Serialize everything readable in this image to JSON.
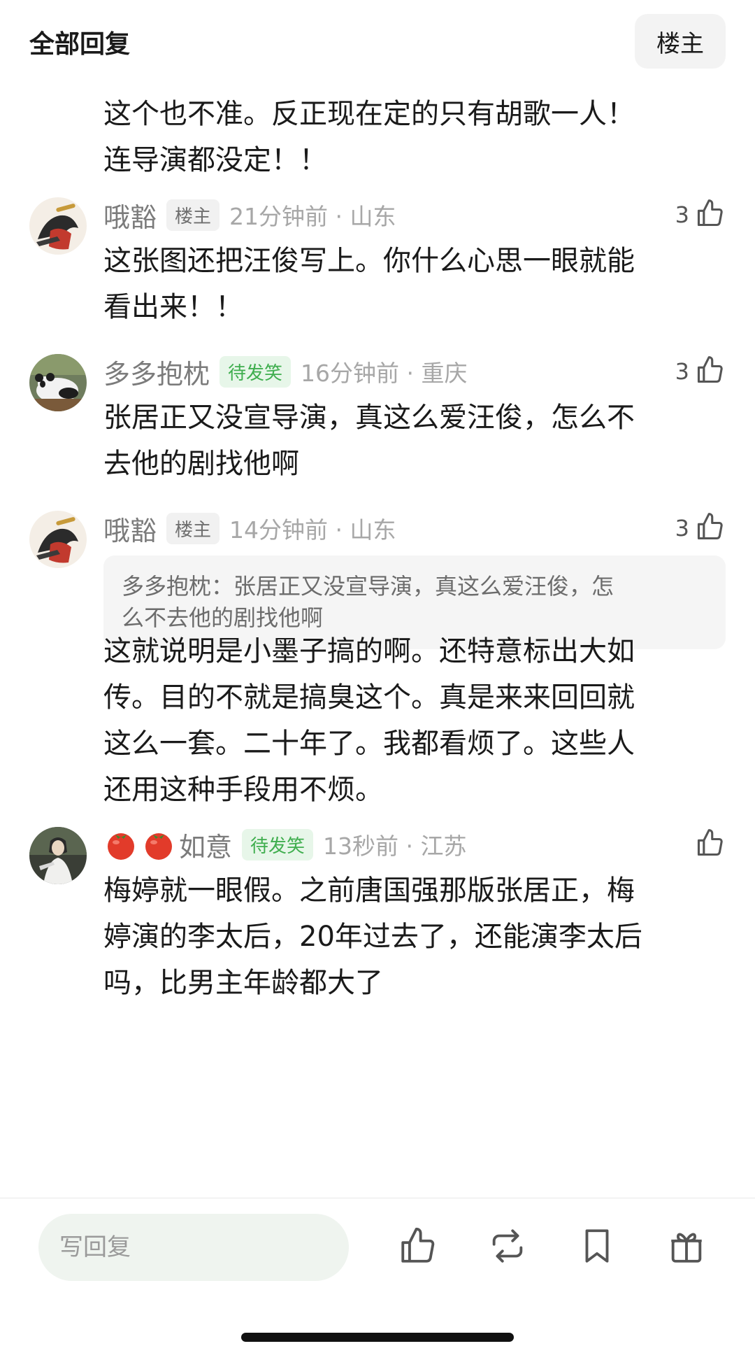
{
  "header": {
    "title": "全部回复",
    "op_filter_label": "楼主"
  },
  "top_text": {
    "lines": [
      "这个也不准。反正现在定的只有胡歌一人！",
      "连导演都没定！！"
    ]
  },
  "comments": [
    {
      "nickname": "哦豁",
      "badge": "楼主",
      "time": "21分钟前 · 山东",
      "likes": "3",
      "text_lines": [
        "这张图还把汪俊写上。你什么心思一眼就能",
        "看出来！！"
      ]
    },
    {
      "nickname": "多多抱枕",
      "badge": "待发笑",
      "time": "16分钟前 · 重庆",
      "likes": "3",
      "text_lines": [
        "张居正又没宣导演，真这么爱汪俊，怎么不",
        "去他的剧找他啊"
      ]
    },
    {
      "nickname": "哦豁",
      "badge": "楼主",
      "time": "14分钟前 · 山东",
      "likes": "3",
      "quote_lines": [
        "多多抱枕：张居正又没宣导演，真这么爱汪俊，怎",
        "么不去他的剧找他啊"
      ],
      "text_lines": [
        "这就说明是小墨子搞的啊。还特意标出大如",
        "传。目的不就是搞臭这个。真是来来回回就",
        "这么一套。二十年了。我都看烦了。这些人",
        "还用这种手段用不烦。"
      ]
    },
    {
      "nickname": "如意",
      "nickname_emoji": [
        "tomato-emoji",
        "tomato-emoji"
      ],
      "badge": "待发笑",
      "time": "13秒前 · 江苏",
      "likes": "",
      "text_lines": [
        "梅婷就一眼假。之前唐国强那版张居正，梅",
        "婷演的李太后，20年过去了，还能演李太后",
        "吗，比男主年龄都大了"
      ]
    }
  ],
  "bottom_bar": {
    "reply_placeholder": "写回复",
    "actions": [
      "like-icon",
      "repost-icon",
      "bookmark-icon",
      "gift-icon"
    ]
  },
  "colors": {
    "badge_green_bg": "#e7f6e9",
    "badge_green_text": "#3fae4e",
    "reply_bg": "#eff4ef"
  }
}
